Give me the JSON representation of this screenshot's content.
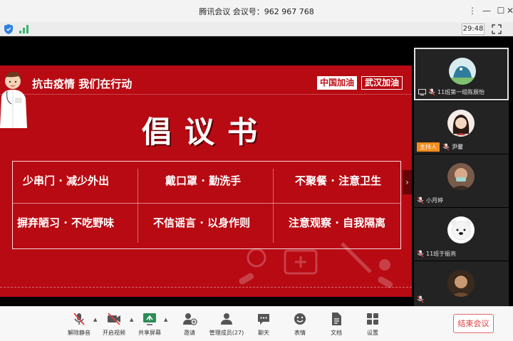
{
  "window": {
    "title": "腾讯会议 会议号：962 967 768",
    "controls": [
      "more-icon",
      "minimize-icon",
      "maximize-icon",
      "close-icon"
    ]
  },
  "status": {
    "timer": "29:48"
  },
  "slide": {
    "header": "抗击疫情 我们在行动",
    "tag_a": "中国加油",
    "tag_b": "武汉加油",
    "title": "倡议书",
    "cells": [
      "少串门 · 减少外出",
      "戴口罩 · 勤洗手",
      "不聚餐 · 注意卫生",
      "摒弃陋习 · 不吃野味",
      "不信谣言 · 以身作则",
      "注意观察 · 自我隔离"
    ]
  },
  "participants": [
    {
      "name": "11班第一组陈辰怡",
      "active": true
    },
    {
      "name": "尹馨",
      "host_label": "主持人"
    },
    {
      "name": "小月婷"
    },
    {
      "name": "11班于振亮"
    },
    {
      "name": ""
    }
  ],
  "toolbar": {
    "items": [
      {
        "label": "解除静音",
        "icon": "mic-muted-icon"
      },
      {
        "label": "开启视频",
        "icon": "camera-off-icon"
      },
      {
        "label": "共享屏幕",
        "icon": "share-screen-icon"
      },
      {
        "label": "邀请",
        "icon": "invite-icon"
      },
      {
        "label": "管理成员(27)",
        "icon": "members-icon"
      },
      {
        "label": "聊天",
        "icon": "chat-icon"
      },
      {
        "label": "表情",
        "icon": "emoji-icon"
      },
      {
        "label": "文档",
        "icon": "document-icon"
      },
      {
        "label": "设置",
        "icon": "settings-icon"
      }
    ],
    "end_label": "结束会议"
  },
  "colors": {
    "slide_red": "#b80a13",
    "host_badge": "#f28c1b",
    "end_red": "#e03a3a"
  }
}
